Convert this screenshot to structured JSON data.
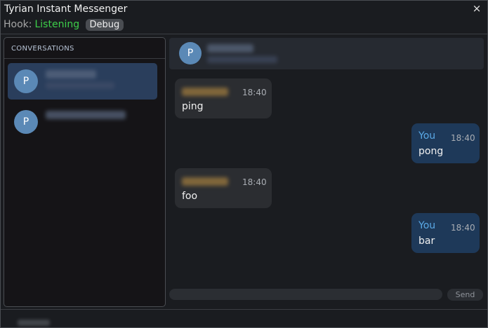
{
  "window": {
    "title": "Tyrian Instant Messenger",
    "close_icon": "×"
  },
  "hook": {
    "label": "Hook:",
    "status": "Listening",
    "debug_label": "Debug"
  },
  "sidebar": {
    "header": "CONVERSATIONS",
    "conversations": [
      {
        "avatar": "P",
        "active": true
      },
      {
        "avatar": "P",
        "active": false
      }
    ]
  },
  "chat": {
    "header_avatar": "P",
    "messages": [
      {
        "direction": "in",
        "sender": "",
        "time": "18:40",
        "text": "ping"
      },
      {
        "direction": "out",
        "sender": "You",
        "time": "18:40",
        "text": "pong"
      },
      {
        "direction": "in",
        "sender": "",
        "time": "18:40",
        "text": "foo"
      },
      {
        "direction": "out",
        "sender": "You",
        "time": "18:40",
        "text": "bar"
      }
    ],
    "composer_placeholder": "",
    "send_label": "Send"
  },
  "colors": {
    "accent_blue": "#5aa9e6",
    "status_green": "#3dcf4a",
    "active_conversation": "#2a3e5c",
    "outgoing_bubble": "#1e3959",
    "incoming_bubble": "#2b2d31"
  }
}
